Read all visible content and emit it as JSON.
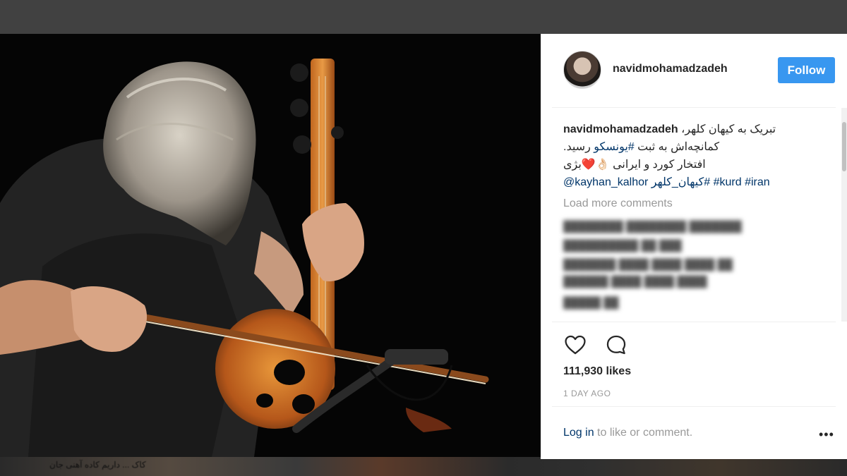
{
  "post": {
    "username": "navidmohamadzadeh",
    "follow_label": "Follow",
    "caption": {
      "author": "navidmohamadzadeh",
      "line1": "تبریک به کیهان کلهر،",
      "line2_prefix": "کمانچه‌اش به ثبت ",
      "line2_tag": "#یونسکو",
      "line2_suffix": " رسید.",
      "line3": "افتخار کورد و ایرانی 👌🏻❤️بژی",
      "mention": "@kayhan_kalhor",
      "tag_fa": "#کیهان_کلهر",
      "tag_kurd": "#kurd",
      "tag_iran": "#iran"
    },
    "load_more": "Load more comments",
    "likes": "111,930 likes",
    "time_ago": "1 DAY AGO",
    "login_link": "Log in",
    "login_suffix": " to like or comment.",
    "more_options": "•••"
  },
  "icons": {
    "like": "heart-icon",
    "comment": "comment-bubble-icon"
  },
  "colors": {
    "follow_button": "#3897f0",
    "link": "#003569",
    "muted_text": "#999999"
  },
  "bottom_strip_text": "کاک ... داریم کاده آهنی جان"
}
